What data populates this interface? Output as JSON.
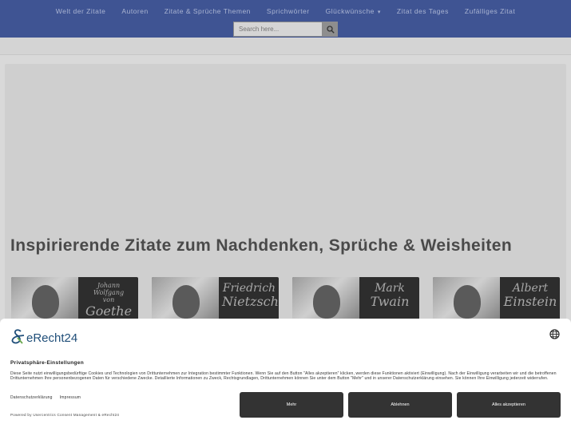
{
  "nav": {
    "items": [
      {
        "label": "Welt der Zitate"
      },
      {
        "label": "Autoren"
      },
      {
        "label": "Zitate & Sprüche Themen"
      },
      {
        "label": "Sprichwörter"
      },
      {
        "label": "Glückwünsche",
        "has_submenu": true
      },
      {
        "label": "Zitat des Tages"
      },
      {
        "label": "Zufälliges Zitat"
      }
    ],
    "search": {
      "placeholder": "Search here...",
      "icon": "search-icon"
    }
  },
  "main": {
    "headline": "Inspirierende Zitate zum Nachdenken, Sprüche & Weisheiten",
    "cards": [
      {
        "line1": "Johann Wolfgang",
        "line2": "von",
        "line3": "Goethe"
      },
      {
        "line1": "Friedrich",
        "line2": "",
        "line3": "Nietzsche"
      },
      {
        "line1": "Mark",
        "line2": "",
        "line3": "Twain"
      },
      {
        "line1": "Albert",
        "line2": "",
        "line3": "Einstein"
      }
    ]
  },
  "consent": {
    "brand": "eRecht24",
    "title": "Privatsphäre-Einstellungen",
    "text": "Diese Seite nutzt einwilligungsbedürftige Cookies und Technologien von Drittunternehmen zur Integration bestimmter Funktionen. Wenn Sie auf den Button \"Alles akzeptieren\" klicken, werden diese Funktionen aktiviert (Einwilligung). Nach der Einwilligung verarbeiten wir und die betroffenen Drittunternehmen Ihre personenbezogenen Daten für verschiedene Zwecke. Detaillierte Informationen zu Zweck, Rechtsgrundlagen, Drittunternehmen können Sie unter dem Button \"Mehr\" und in unserer Datenschutzerklärung einsehen. Sie können Ihre Einwilligung jederzeit widerrufen.",
    "links": {
      "privacy": "Datenschutzerklärung",
      "imprint": "Impressum"
    },
    "powered": "Powered by Usercentrics Consent Management & eRecht24",
    "buttons": {
      "more": "Mehr",
      "decline": "Ablehnen",
      "accept": "Alles akzeptieren"
    }
  },
  "colors": {
    "nav_bg": "#3f5493",
    "button_bg": "#333333",
    "brand_blue": "#1f4e79"
  }
}
